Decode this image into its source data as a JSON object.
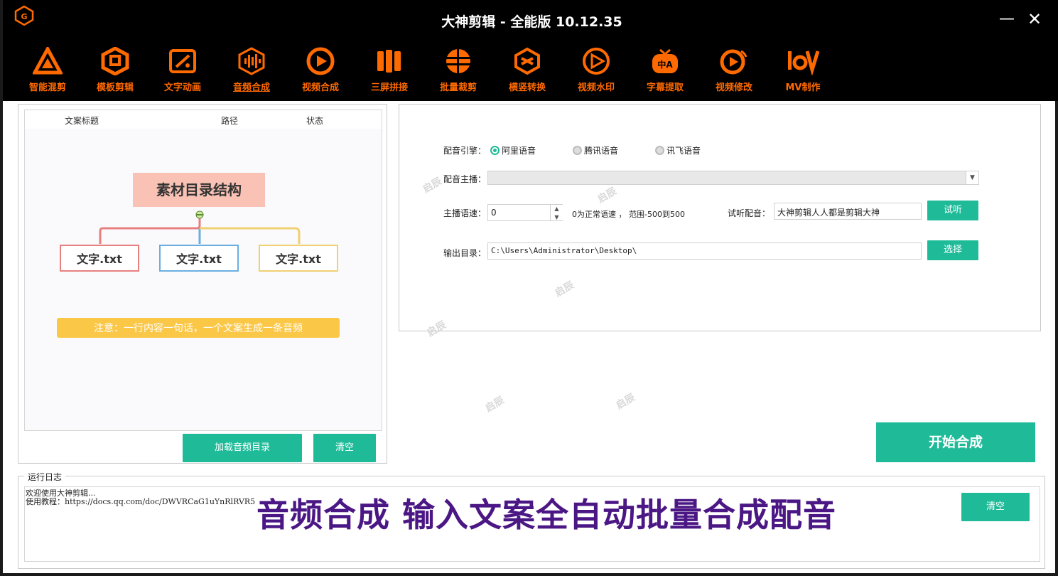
{
  "window": {
    "title": "大神剪辑 - 全能版 10.12.35",
    "minimize_glyph": "—",
    "close_glyph": "✕"
  },
  "colors": {
    "accent": "#ff6a00",
    "teal": "#1fbb99",
    "banner": "#4b1785"
  },
  "toolbar": {
    "items": [
      {
        "label": "智能混剪",
        "icon": "triangle-logo-icon"
      },
      {
        "label": "模板剪辑",
        "icon": "hexagon-template-icon"
      },
      {
        "label": "文字动画",
        "icon": "text-frame-icon"
      },
      {
        "label": "音频合成",
        "icon": "audio-wave-icon",
        "active": true
      },
      {
        "label": "视频合成",
        "icon": "video-circle-icon"
      },
      {
        "label": "三屏拼接",
        "icon": "triple-screen-icon"
      },
      {
        "label": "批量裁剪",
        "icon": "crop-circle-icon"
      },
      {
        "label": "横竖转换",
        "icon": "rotate-cube-icon"
      },
      {
        "label": "视频水印",
        "icon": "watermark-play-icon"
      },
      {
        "label": "字幕提取",
        "icon": "subtitle-tv-icon"
      },
      {
        "label": "视频修改",
        "icon": "video-edit-icon"
      },
      {
        "label": "MV制作",
        "icon": "mv-logo-icon"
      }
    ]
  },
  "left": {
    "columns": [
      "文案标题",
      "路径",
      "状态"
    ],
    "diagram": {
      "root": "素材目录结构",
      "children": [
        "文字.txt",
        "文字.txt",
        "文字.txt"
      ],
      "note": "注意：一行内容一句话，一个文案生成一条音频"
    },
    "load_button": "加载音频目录",
    "clear_button": "清空"
  },
  "right": {
    "engine_label": "配音引擎：",
    "engines": [
      {
        "label": "阿里语音",
        "selected": true
      },
      {
        "label": "腾讯语音",
        "selected": false
      },
      {
        "label": "讯飞语音",
        "selected": false
      }
    ],
    "anchor_label": "配音主播：",
    "anchor_value": "",
    "speed_label": "主播语速：",
    "speed_value": "0",
    "speed_hint": "0为正常语速 ， 范围-500到500",
    "preview_label": "试听配音：",
    "preview_text": "大神剪辑人人都是剪辑大神",
    "listen_button": "试听",
    "output_label": "输出目录：",
    "output_path": "C:\\Users\\Administrator\\Desktop\\",
    "choose_button": "选择"
  },
  "start_button": "开始合成",
  "log": {
    "legend": "运行日志",
    "lines": [
      "欢迎使用大神剪辑...",
      "使用教程：https://docs.qq.com/doc/DWVRCaG1uYnRlRVR5"
    ],
    "clear_button": "清空"
  },
  "banner": "音频合成 输入文案全自动批量合成配音",
  "watermark": "启辰"
}
